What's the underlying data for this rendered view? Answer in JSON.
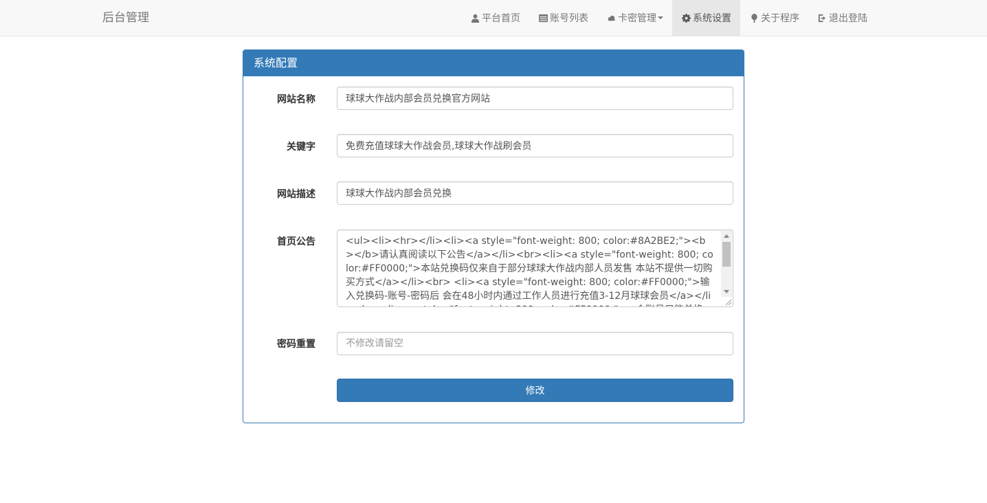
{
  "navbar": {
    "brand": "后台管理",
    "items": [
      {
        "label": "平台首页",
        "icon": "user-icon"
      },
      {
        "label": "账号列表",
        "icon": "list-icon"
      },
      {
        "label": "卡密管理",
        "icon": "cloud-icon",
        "dropdown": true
      },
      {
        "label": "系统设置",
        "icon": "gear-icon",
        "active": true
      },
      {
        "label": "关于程序",
        "icon": "tree-icon"
      },
      {
        "label": "退出登陆",
        "icon": "logout-icon"
      }
    ]
  },
  "panel": {
    "title": "系统配置",
    "fields": {
      "site_name": {
        "label": "网站名称",
        "value": "球球大作战内部会员兑换官方网站"
      },
      "keywords": {
        "label": "关键字",
        "value": "免费充值球球大作战会员,球球大作战刷会员"
      },
      "description": {
        "label": "网站描述",
        "value": "球球大作战内部会员兑换"
      },
      "notice": {
        "label": "首页公告",
        "value": "<ul><li><hr></li><li><a style=\"font-weight: 800; color:#8A2BE2;\"><b></b>请认真阅读以下公告</a></li><br><li><a  style=\"font-weight: 800; color:#FF0000;\">本站兑换码仅来自于部分球球大作战内部人员发售 本站不提供一切购买方式</a></li><br>\n<li><a  style=\"font-weight: 800; color:#FF0000;\">输入兑换码-账号-密码后 会在48小时内通过工作人员进行充值3-12月球球会员</a></li><br><li><a  style=\"font-weight: 800; color:#FF0000;\">一个账号只能兑换一次 如果重复兑换将不会充值到账会员</a> 且不退还兑换码</li>"
      },
      "password": {
        "label": "密码重置",
        "placeholder": "不修改请留空"
      }
    },
    "submit_label": "修改"
  }
}
